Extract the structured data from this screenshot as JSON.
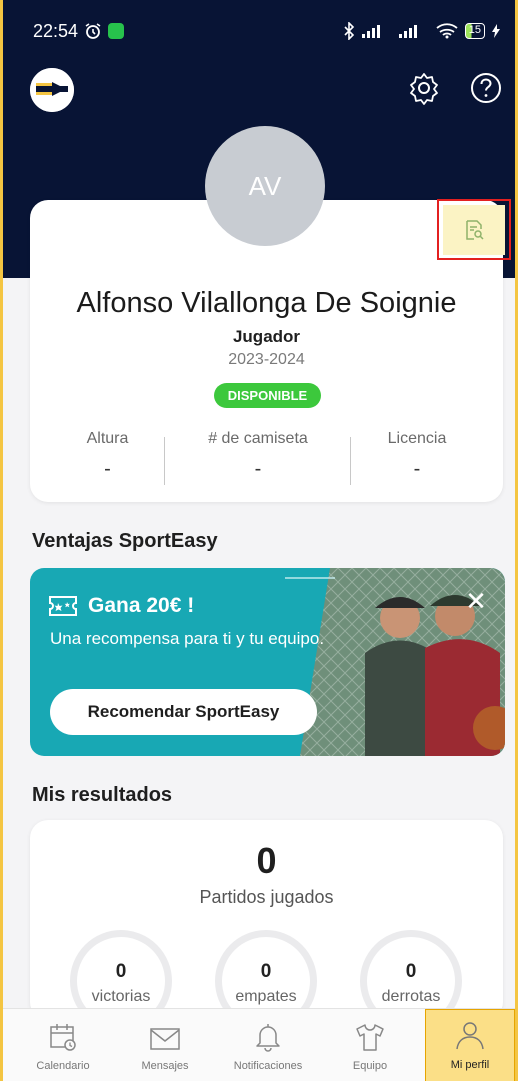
{
  "status_bar": {
    "time": "22:54",
    "battery": "15"
  },
  "player": {
    "initials": "AV",
    "name": "Alfonso Vilallonga De Soignie",
    "role": "Jugador",
    "season": "2023-2024",
    "status_badge": "DISPONIBLE",
    "stats": [
      {
        "label": "Altura",
        "value": "-"
      },
      {
        "label": "# de camiseta",
        "value": "-"
      },
      {
        "label": "Licencia",
        "value": "-"
      }
    ]
  },
  "promo_section": {
    "title": "Ventajas SportEasy",
    "promo_title": "Gana 20€ !",
    "promo_desc": "Una recompensa para ti y tu equipo.",
    "promo_button": "Recomendar SportEasy",
    "close": "✕"
  },
  "results": {
    "title": "Mis resultados",
    "played_value": "0",
    "played_label": "Partidos jugados",
    "rings": [
      {
        "value": "0",
        "label": "victorias"
      },
      {
        "value": "0",
        "label": "empates"
      },
      {
        "value": "0",
        "label": "derrotas"
      }
    ]
  },
  "bottom_nav": [
    {
      "label": "Calendario",
      "icon": "calendar-icon"
    },
    {
      "label": "Mensajes",
      "icon": "envelope-icon"
    },
    {
      "label": "Notificaciones",
      "icon": "bell-icon"
    },
    {
      "label": "Equipo",
      "icon": "shirt-icon"
    },
    {
      "label": "Mi perfil",
      "icon": "person-icon"
    }
  ],
  "colors": {
    "header": "#081435",
    "promo": "#18a8b4",
    "badge": "#3cc83c",
    "nav_active": "#fbdf87",
    "highlight_border": "#e32020"
  }
}
